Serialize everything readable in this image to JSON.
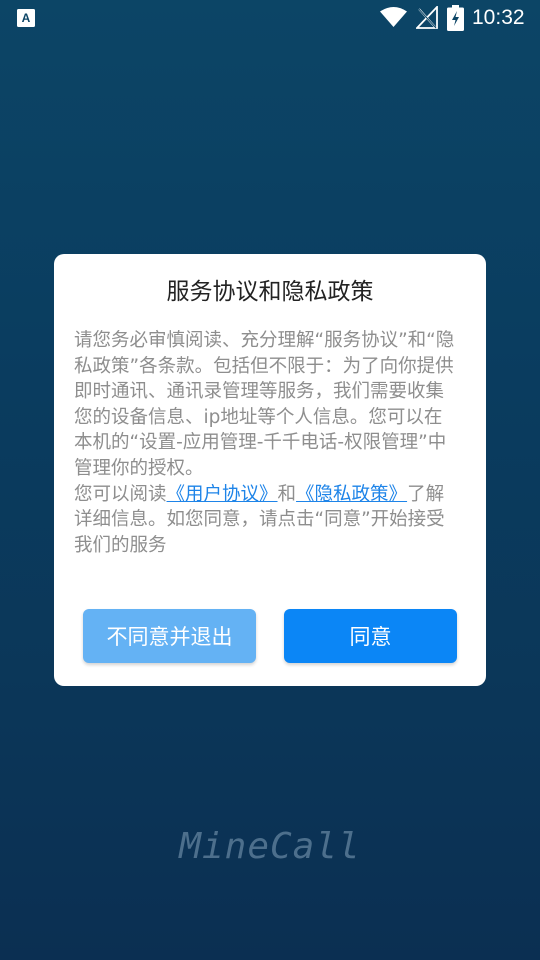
{
  "status_bar": {
    "time": "10:32",
    "left_icon": "a-notification-icon",
    "icons": [
      "wifi-icon",
      "no-signal-icon",
      "battery-charging-icon"
    ]
  },
  "dialog": {
    "title": "服务协议和隐私政策",
    "paragraph1": "请您务必审慎阅读、充分理解“服务协议”和“隐私政策”各条款。包括但不限于：为了向你提供即时通讯、通讯录管理等服务，我们需要收集您的设备信息、ip地址等个人信息。您可以在本机的“设置-应用管理-千千电话-权限管理”中管理你的授权。",
    "p2_prefix": "您可以阅读",
    "user_agreement_link": "《用户协议》",
    "p2_and": "和",
    "privacy_policy_link": "《隐私政策》",
    "p2_suffix": "了解详细信息。如您同意，请点击“同意”开始接受我们的服务",
    "disagree_button": "不同意并退出",
    "agree_button": "同意"
  },
  "brand": {
    "name": "MineCall"
  },
  "colors": {
    "background_top": "#0c4566",
    "background_bottom": "#0b2f52",
    "link": "#1e84e8",
    "agree_button": "#0b86f6",
    "disagree_button": "#64b2f4",
    "body_text": "#8e8e8e"
  }
}
